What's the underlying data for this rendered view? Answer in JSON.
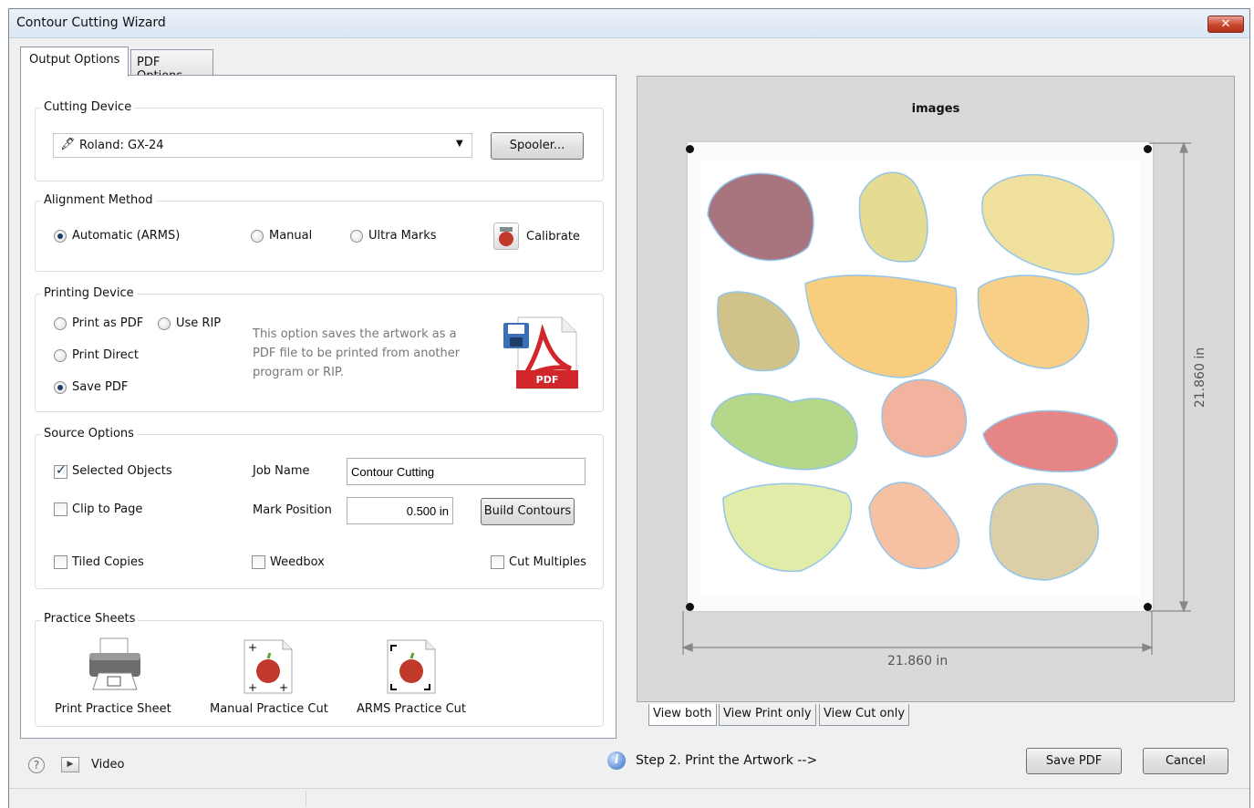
{
  "window": {
    "title": "Contour Cutting Wizard",
    "close_label": "✕"
  },
  "tabs": [
    {
      "label": "Output Options"
    },
    {
      "label": "PDF Options"
    }
  ],
  "cutting_device": {
    "group_label": "Cutting Device",
    "device_value": "Roland: GX-24",
    "spooler_label": "Spooler..."
  },
  "alignment": {
    "group_label": "Alignment Method",
    "automatic_label": "Automatic (ARMS)",
    "manual_label": "Manual",
    "ultra_label": "Ultra Marks",
    "calibrate_label": "Calibrate",
    "selected": "automatic"
  },
  "printing": {
    "group_label": "Printing Device",
    "print_pdf_label": "Print as PDF",
    "use_rip_label": "Use RIP",
    "print_direct_label": "Print Direct",
    "save_pdf_label": "Save PDF",
    "description": "This option saves the artwork as a PDF file to be printed from another program or RIP.",
    "pdf_icon_text": "PDF",
    "selected": "save_pdf"
  },
  "source": {
    "group_label": "Source Options",
    "selected_objects_label": "Selected Objects",
    "selected_objects_checked": true,
    "clip_to_page_label": "Clip to Page",
    "tiled_copies_label": "Tiled Copies",
    "job_name_label": "Job Name",
    "job_name_value": "Contour Cutting",
    "mark_position_label": "Mark Position",
    "mark_position_value": "0.500 in",
    "build_contours_label": "Build Contours",
    "weedbox_label": "Weedbox",
    "cut_multiples_label": "Cut Multiples"
  },
  "practice": {
    "group_label": "Practice Sheets",
    "print_sheet_label": "Print Practice Sheet",
    "manual_cut_label": "Manual Practice Cut",
    "arms_cut_label": "ARMS Practice Cut"
  },
  "preview": {
    "title": "images",
    "width_label": "21.860 in",
    "height_label": "21.860 in",
    "view_tabs": [
      "View both",
      "View Print only",
      "View Cut only"
    ]
  },
  "footer": {
    "help_icon": "?",
    "video_label": "Video",
    "step_text": "Step 2. Print the Artwork -->",
    "save_pdf_label": "Save PDF",
    "cancel_label": "Cancel"
  },
  "colors": {
    "accent": "#1e3e67",
    "contour": "#5aa7e0",
    "close": "#c9462d"
  }
}
